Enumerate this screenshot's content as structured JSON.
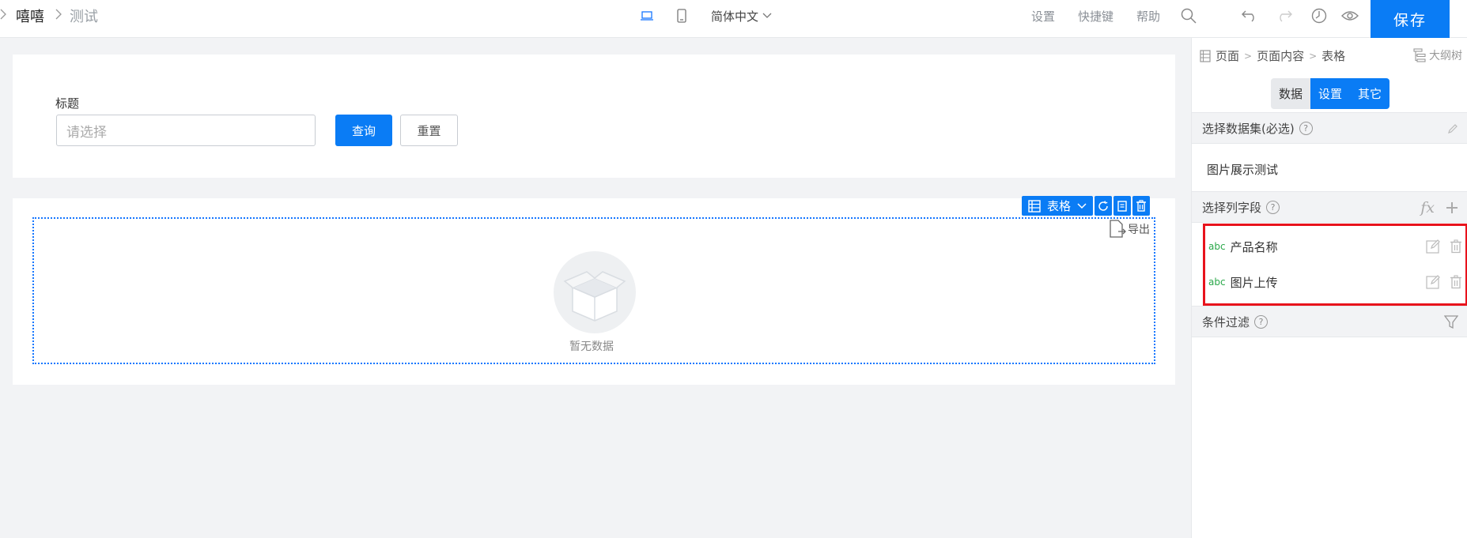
{
  "header": {
    "breadcrumb": {
      "home": "嘻嘻",
      "current": "测试"
    },
    "language": "简体中文",
    "links": {
      "settings": "设置",
      "shortcuts": "快捷键",
      "help": "帮助"
    },
    "save_label": "保存"
  },
  "canvas": {
    "filter": {
      "label": "标题",
      "placeholder": "请选择",
      "query_label": "查询",
      "reset_label": "重置"
    },
    "table": {
      "toolbar_label": "表格",
      "export_label": "导出",
      "empty_text": "暂无数据"
    }
  },
  "panel": {
    "breadcrumb": [
      "页面",
      "页面内容",
      "表格"
    ],
    "outline_label": "大纲树",
    "tabs": [
      {
        "label": "数据",
        "active": false
      },
      {
        "label": "设置",
        "active": true
      },
      {
        "label": "其它",
        "active": false
      }
    ],
    "dataset": {
      "title": "选择数据集(必选)",
      "value": "图片展示测试"
    },
    "columns": {
      "title": "选择列字段",
      "fx_label": "fx",
      "items": [
        {
          "type": "abc",
          "name": "产品名称"
        },
        {
          "type": "abc",
          "name": "图片上传"
        }
      ]
    },
    "filter_title": "条件过滤"
  },
  "colors": {
    "accent": "#0a7cf5",
    "highlight": "#e8131c",
    "field_type": "#2aa84a"
  }
}
